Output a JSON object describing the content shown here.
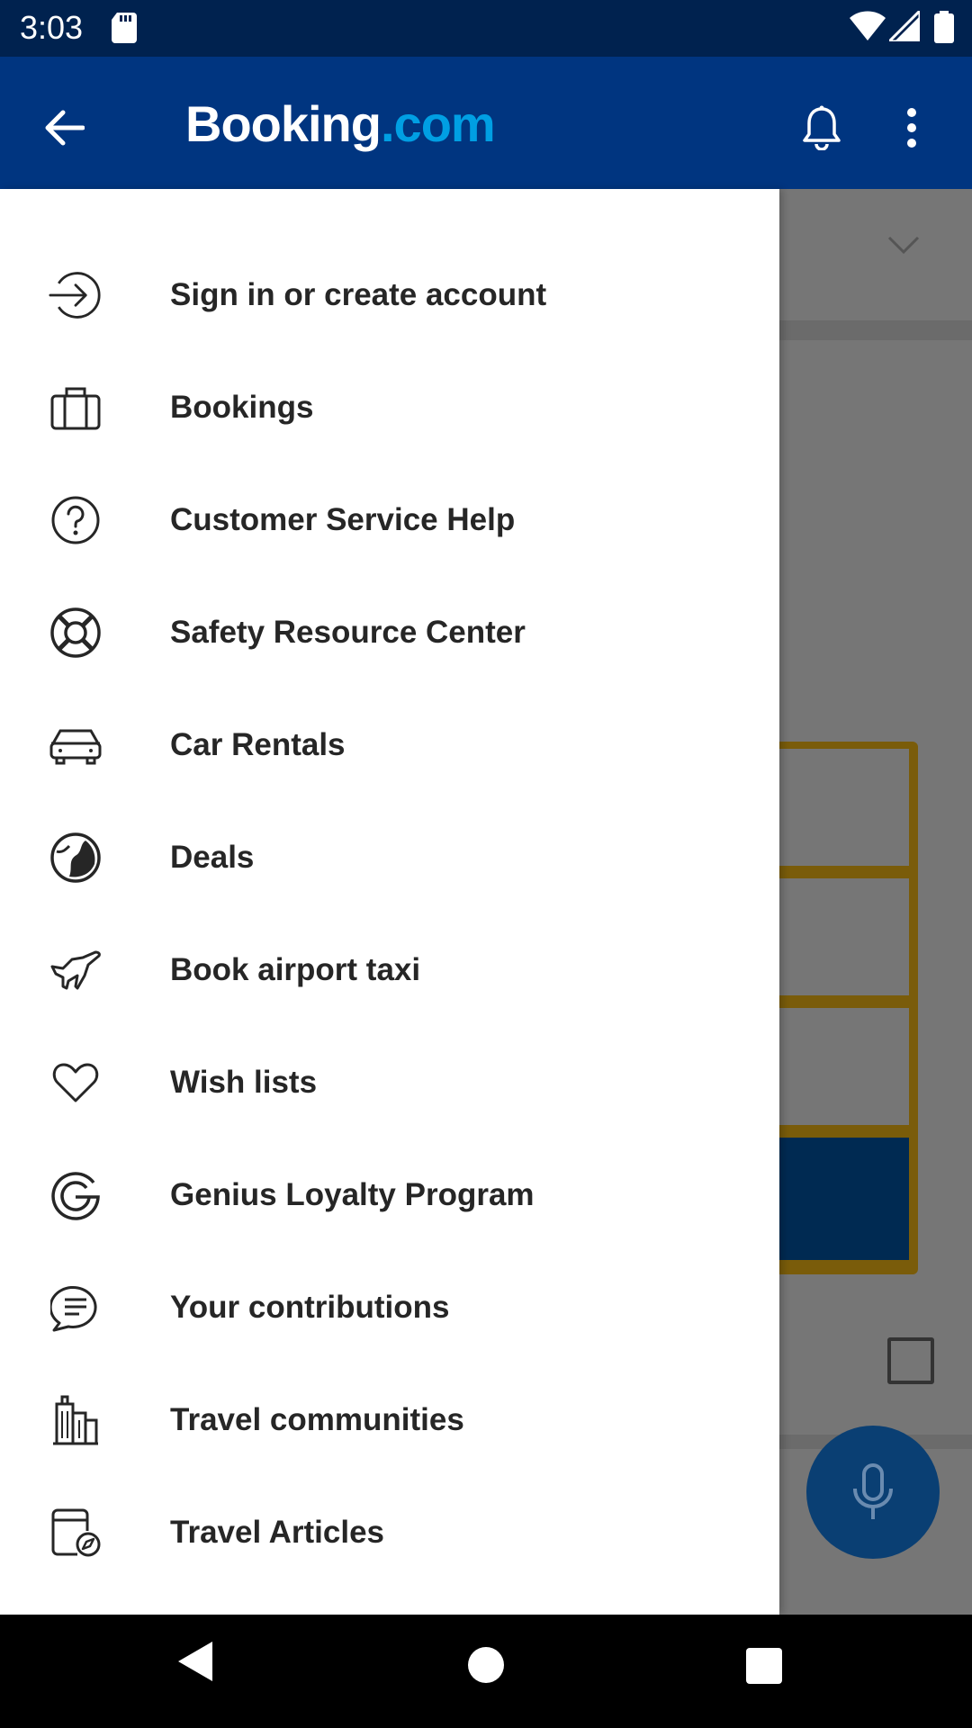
{
  "status_bar": {
    "time": "3:03",
    "icons": [
      "sd-card-icon",
      "wifi-icon",
      "signal-icon",
      "battery-icon"
    ]
  },
  "app_bar": {
    "logo_main": "Booking",
    "logo_suffix": ".com",
    "back_icon": "arrow-left-icon",
    "bell_icon": "bell-icon",
    "more_icon": "more-vertical-icon",
    "colors": {
      "background": "#003580",
      "logo_accent": "#009fe3"
    }
  },
  "drawer": {
    "items": [
      {
        "label": "Sign in or create account",
        "icon": "sign-in-icon"
      },
      {
        "label": "Bookings",
        "icon": "briefcase-icon"
      },
      {
        "label": "Customer Service Help",
        "icon": "help-circle-icon"
      },
      {
        "label": "Safety Resource Center",
        "icon": "lifebuoy-icon"
      },
      {
        "label": "Car Rentals",
        "icon": "car-icon"
      },
      {
        "label": "Deals",
        "icon": "deals-globe-icon"
      },
      {
        "label": "Book airport taxi",
        "icon": "airplane-icon"
      },
      {
        "label": "Wish lists",
        "icon": "heart-icon"
      },
      {
        "label": "Genius Loyalty Program",
        "icon": "genius-icon"
      },
      {
        "label": "Your contributions",
        "icon": "chat-bubble-icon"
      },
      {
        "label": "Travel communities",
        "icon": "city-buildings-icon"
      },
      {
        "label": "Travel Articles",
        "icon": "articles-icon"
      }
    ]
  },
  "background": {
    "mic_icon": "microphone-icon"
  },
  "nav_bar": {
    "icons": [
      "nav-back-icon",
      "nav-home-icon",
      "nav-recents-icon"
    ]
  }
}
